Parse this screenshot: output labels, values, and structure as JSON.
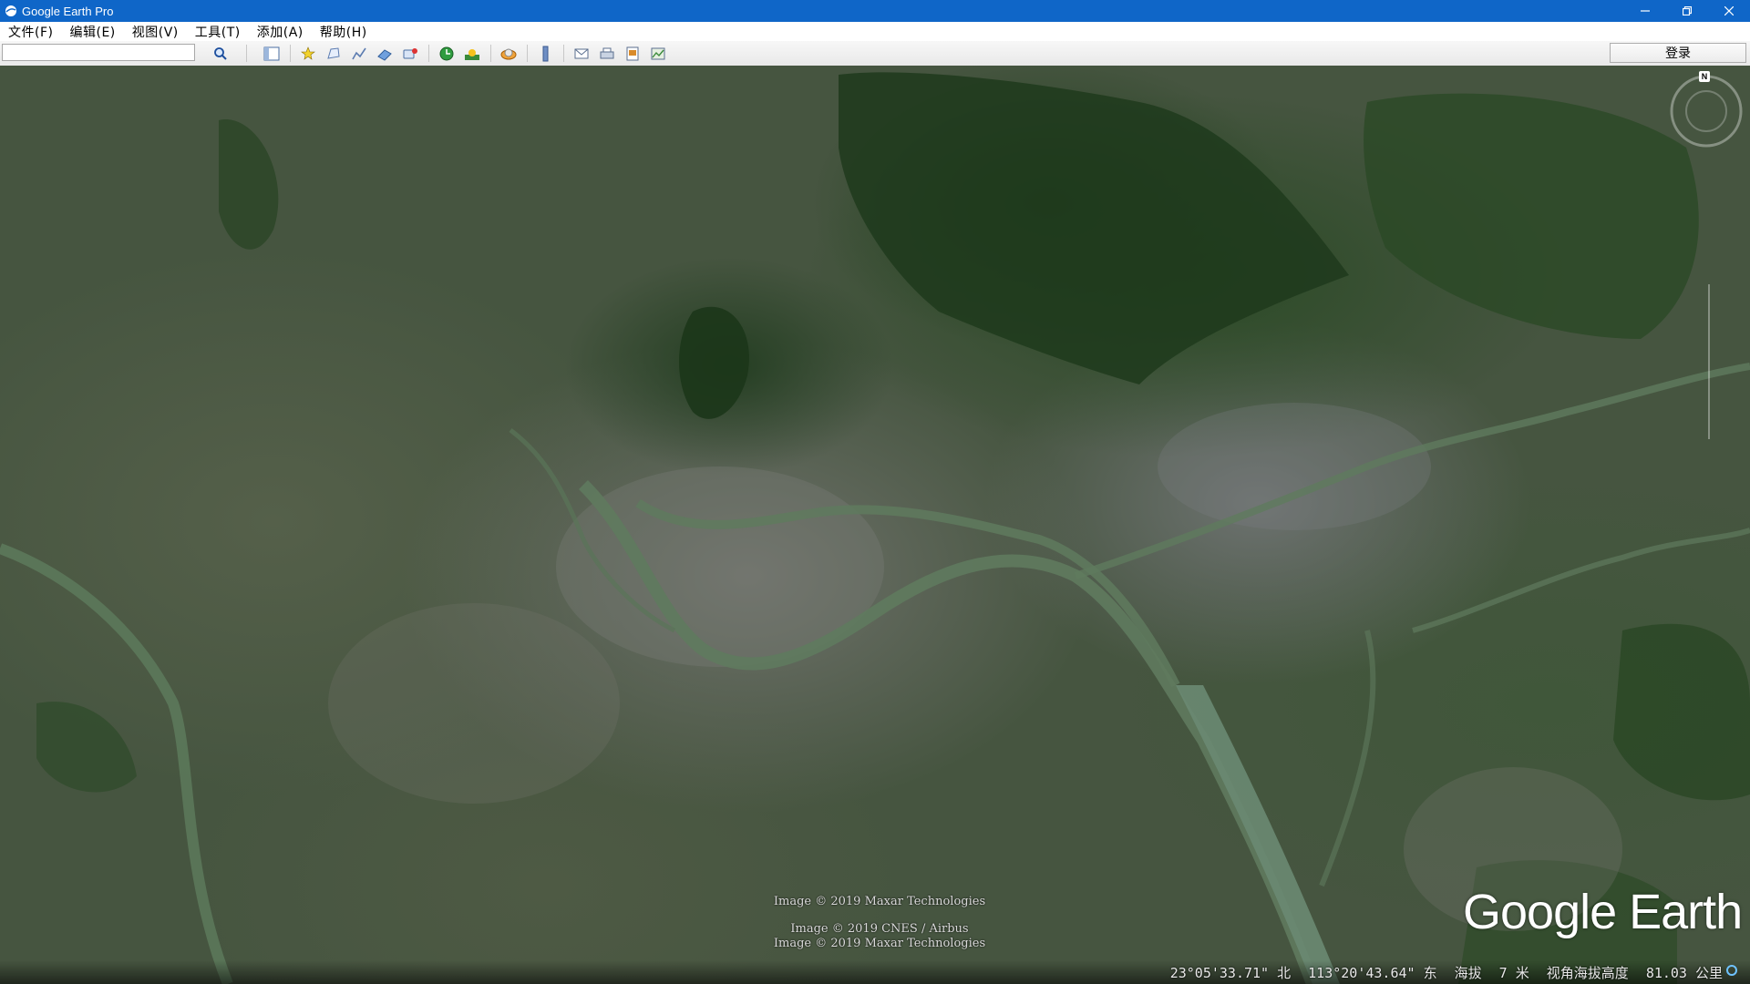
{
  "window": {
    "title": "Google Earth Pro"
  },
  "menu": {
    "items": [
      "文件(F)",
      "编辑(E)",
      "视图(V)",
      "工具(T)",
      "添加(A)",
      "帮助(H)"
    ]
  },
  "toolbar": {
    "search_value": "",
    "login_label": "登录",
    "buttons": [
      "sidebar-toggle-icon",
      "placemark-icon",
      "polygon-icon",
      "path-icon",
      "image-overlay-icon",
      "record-tour-icon",
      "historical-imagery-icon",
      "sunlight-icon",
      "planet-icon",
      "ruler-icon",
      "email-icon",
      "print-icon",
      "save-image-icon",
      "view-in-maps-icon"
    ]
  },
  "map": {
    "compass_label": "N",
    "credits": [
      "Image © 2019 Maxar Technologies",
      "Image © 2019 CNES / Airbus",
      "Image © 2019 Maxar Technologies"
    ],
    "logo": "Google Earth"
  },
  "status": {
    "lat": "23°05'33.71\" 北",
    "lon": "113°20'43.64\" 东",
    "elevation_label": "海拔",
    "elevation_value": "7 米",
    "eye_alt_label": "视角海拔高度",
    "eye_alt_value": "81.03 公里"
  },
  "colors": {
    "titlebar": "#0f66c8",
    "river": "#5f7a5e",
    "forest": "#24401f"
  }
}
